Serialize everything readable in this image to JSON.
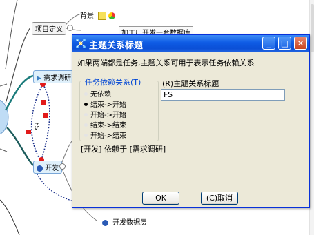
{
  "mindmap": {
    "node_background_label": "背景",
    "node_project_definition": "项目定义",
    "node_behind_text": "加工厂开发一套数据库",
    "node_requirements": "需求调研",
    "node_develop": "开发",
    "node_develop_data_layer": "开发数据层",
    "link_label": "FS"
  },
  "dialog": {
    "title": "主题关系标题",
    "description": "如果两端都是任务,主题关系可用于表示任务依赖关系",
    "dependency_group_label": "任务依赖关系(T)",
    "dependency_options": [
      "无依赖",
      "结束->开始",
      "开始->开始",
      "结束->结束",
      "开始->结束"
    ],
    "selected_option": "结束->开始",
    "dependency_text": "[开发] 依赖于 [需求调研]",
    "title_field_label": "(R)主题关系标题",
    "title_field_value": "FS",
    "ok_label": "OK",
    "cancel_label": "(C)取消",
    "minimize_glyph": "_",
    "maximize_glyph": "□",
    "close_glyph": "✕"
  }
}
